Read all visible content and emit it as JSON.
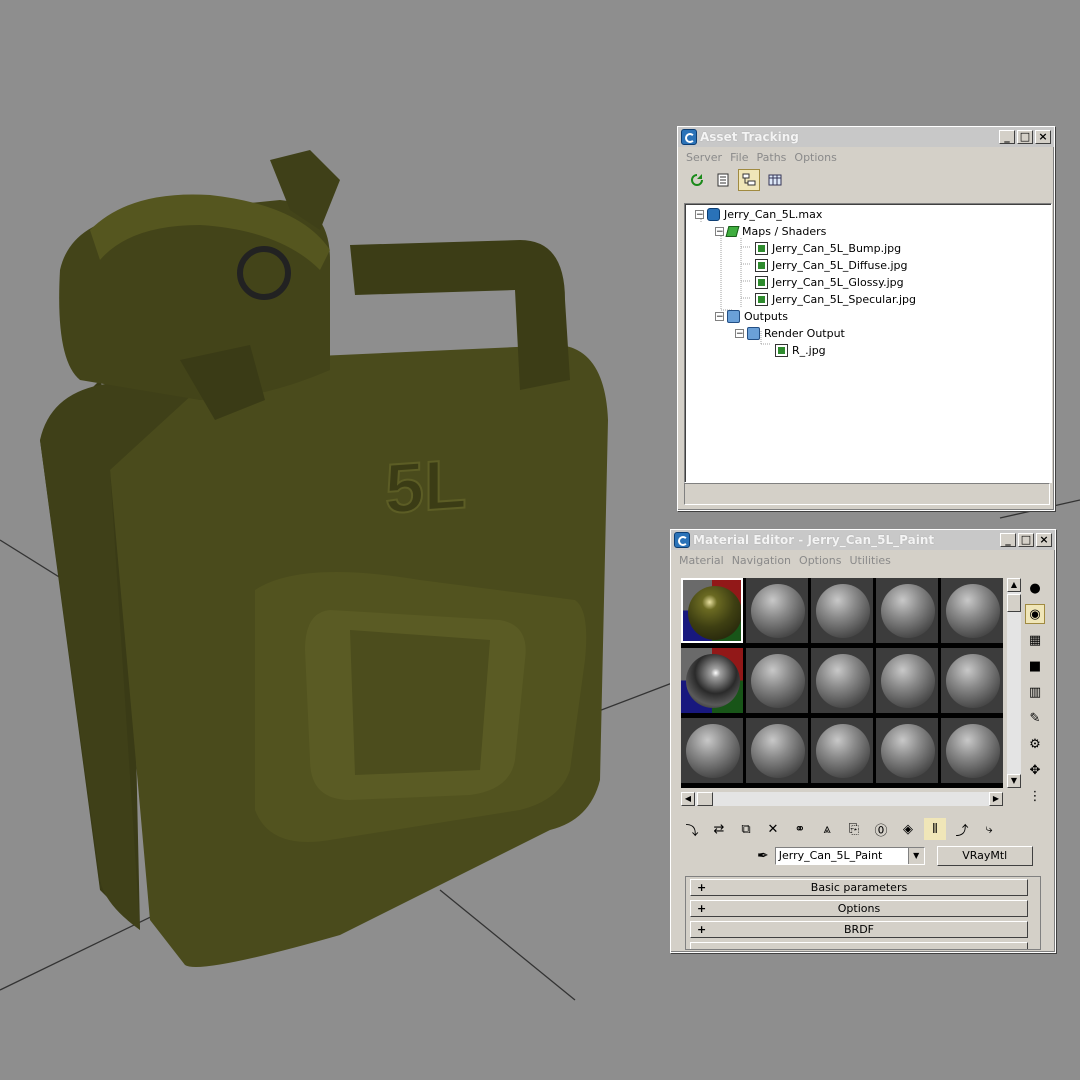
{
  "asset_tracking": {
    "title": "Asset Tracking",
    "menu": [
      "Server",
      "File",
      "Paths",
      "Options"
    ],
    "tree": [
      {
        "label": "Jerry_Can_5L.max"
      },
      {
        "label": "Maps / Shaders"
      },
      {
        "label": "Jerry_Can_5L_Bump.jpg"
      },
      {
        "label": "Jerry_Can_5L_Diffuse.jpg"
      },
      {
        "label": "Jerry_Can_5L_Glossy.jpg"
      },
      {
        "label": "Jerry_Can_5L_Specular.jpg"
      },
      {
        "label": "Outputs"
      },
      {
        "label": "Render Output"
      },
      {
        "label": "R_.jpg"
      }
    ],
    "toolbar_icons": [
      "refresh-icon",
      "list-icon",
      "tree-view-icon",
      "table-view-icon"
    ]
  },
  "material_editor": {
    "title": "Material Editor - Jerry_Can_5L_Paint",
    "menu": [
      "Material",
      "Navigation",
      "Options",
      "Utilities"
    ],
    "material_name": "Jerry_Can_5L_Paint",
    "material_type": "VRayMtl",
    "rollouts": [
      "Basic parameters",
      "Options",
      "BRDF"
    ]
  },
  "viewport": {
    "can_label": "5L",
    "colors": {
      "background": "#8e8e8e",
      "can_body": "#4a4b1c",
      "can_highlight": "#6b6c2a",
      "can_shadow": "#2e2f10"
    }
  },
  "window_buttons": {
    "minimize": "_",
    "maximize": "□",
    "close": "×"
  }
}
